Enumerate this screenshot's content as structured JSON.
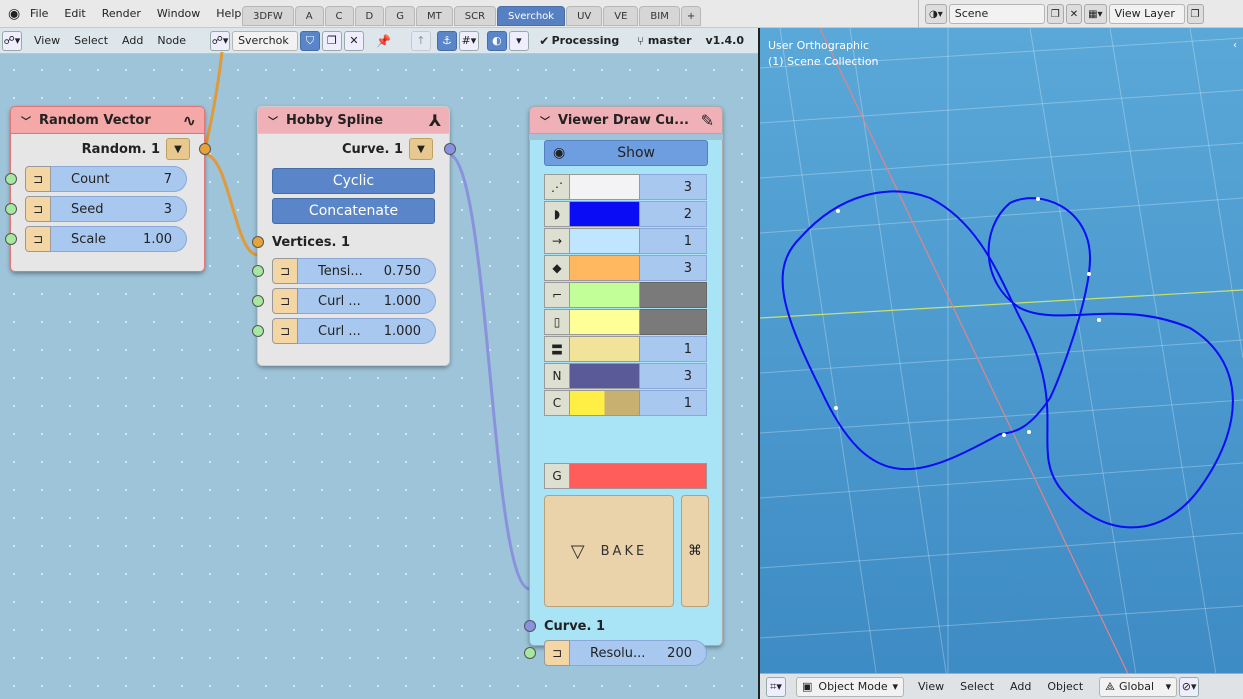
{
  "menubar": {
    "menus": [
      "File",
      "Edit",
      "Render",
      "Window",
      "Help"
    ],
    "workspaces": [
      "3DFW",
      "A",
      "C",
      "D",
      "G",
      "MT",
      "SCR",
      "Sverchok",
      "UV",
      "VE",
      "BIM"
    ],
    "active_workspace": "Sverchok",
    "scene_label": "Scene",
    "view_layer_label": "View Layer"
  },
  "node_header": {
    "menus": [
      "View",
      "Select",
      "Add",
      "Node"
    ],
    "tree_name": "Sverchok",
    "processing_label": "Processing",
    "branch": "master",
    "version": "v1.4.0"
  },
  "nodes": {
    "random_vector": {
      "title": "Random Vector",
      "output": "Random. 1",
      "props": [
        {
          "label": "Count",
          "value": "7"
        },
        {
          "label": "Seed",
          "value": "3"
        },
        {
          "label": "Scale",
          "value": "1.00"
        }
      ]
    },
    "hobby_spline": {
      "title": "Hobby Spline",
      "output": "Curve. 1",
      "cyclic_label": "Cyclic",
      "concat_label": "Concatenate",
      "input": "Vertices. 1",
      "props": [
        {
          "label": "Tensi...",
          "value": "0.750"
        },
        {
          "label": "Curl ...",
          "value": "1.000"
        },
        {
          "label": "Curl ...",
          "value": "1.000"
        }
      ]
    },
    "viewer_draw": {
      "title": "Viewer Draw Cu...",
      "show_label": "Show",
      "rows": [
        {
          "icon": "vertex-icon",
          "color": "#f3f3f6",
          "value": "3"
        },
        {
          "icon": "curve-icon",
          "color": "#0a0cf5",
          "value": "2"
        },
        {
          "icon": "arrow-right-icon",
          "color": "#c0e6ff",
          "value": "1"
        },
        {
          "icon": "diamond-icon",
          "color": "#ffb860",
          "value": "3"
        },
        {
          "icon": "control-polygon-icon",
          "color": "#c2ff98",
          "value": ""
        },
        {
          "icon": "bbox-icon",
          "color": "#ffff98",
          "value": ""
        },
        {
          "icon": "line-icon",
          "color": "#f1e49a",
          "value": "1"
        },
        {
          "icon": "n-label-icon",
          "color": "#5a5a98",
          "value": "3"
        },
        {
          "icon": "c-label-icon",
          "color": "#ffee44",
          "value": "1"
        }
      ],
      "g_color": "#ff5c5c",
      "bake_label": "BAKE",
      "input": "Curve. 1",
      "resolution_label": "Resolu...",
      "resolution_value": "200"
    }
  },
  "viewport": {
    "view_name": "User Orthographic",
    "collection": "(1) Scene Collection",
    "mode": "Object Mode",
    "menus": [
      "View",
      "Select",
      "Add",
      "Object"
    ],
    "transform": "Global"
  },
  "colors": {
    "accent": "#5680c2",
    "curve": "#0a0cf5",
    "viewport_bg": "#4a9ad0"
  }
}
